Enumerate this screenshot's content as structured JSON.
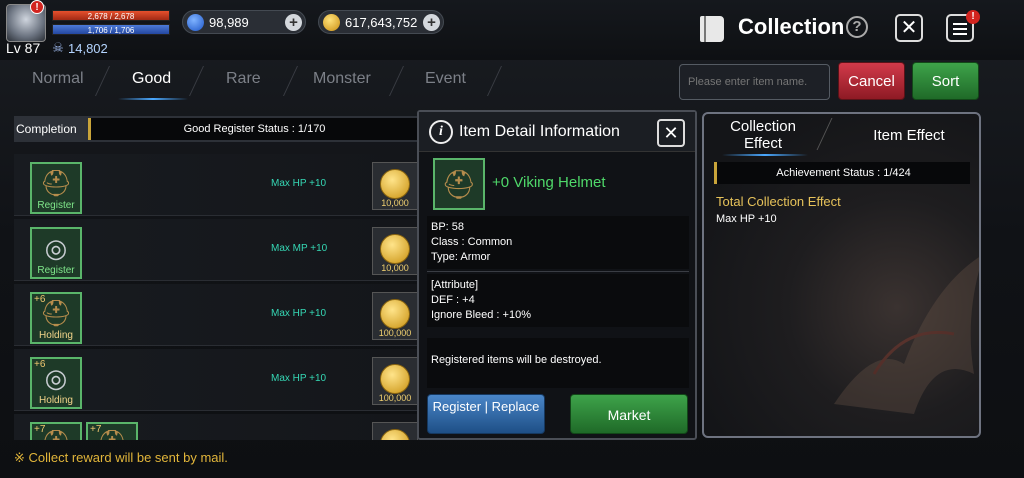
{
  "player": {
    "hp": "2,678 / 2,678",
    "hp_ratio": 1.0,
    "mp": "1,706 / 1,706",
    "mp_ratio": 1.0,
    "level": "Lv 87",
    "battle_power": "14,802",
    "avatar_badge": "!"
  },
  "currencies": [
    {
      "value": "98,989",
      "icon": "blue-gem-icon"
    },
    {
      "value": "617,643,752",
      "icon": "gold-coin-icon"
    }
  ],
  "header": {
    "title": "Collection",
    "menu_badge": "!"
  },
  "tabs": [
    "Normal",
    "Good",
    "Rare",
    "Monster",
    "Event"
  ],
  "active_tab": "Good",
  "search": {
    "placeholder": "Please enter item name."
  },
  "buttons": {
    "cancel": "Cancel",
    "sort": "Sort"
  },
  "completion": {
    "label": "Completion",
    "status": "Good Register Status : 1/170"
  },
  "rows": [
    {
      "state": "Register",
      "plus": "",
      "effect": "Max HP +10",
      "reward": "10,000",
      "icon": "helmet-icon"
    },
    {
      "state": "Register",
      "plus": "",
      "effect": "Max MP +10",
      "reward": "10,000",
      "icon": "ring-icon"
    },
    {
      "state": "Holding",
      "plus": "+6",
      "effect": "Max HP +10",
      "reward": "100,000",
      "icon": "helmet-icon"
    },
    {
      "state": "Holding",
      "plus": "+6",
      "effect": "Max HP +10",
      "reward": "100,000",
      "icon": "ring-icon"
    },
    {
      "state": "",
      "plus": "+7",
      "effect": "",
      "reward": "",
      "icon": "helmet-icon"
    }
  ],
  "footnote": "※ Collect reward will be sent by mail.",
  "detail": {
    "title": "Item Detail Information",
    "item_name": "+0 Viking Helmet",
    "bp": "BP: 58",
    "class": "Class : Common",
    "type": "Type: Armor",
    "attribute_header": "[Attribute]",
    "def": "DEF : +4",
    "ignore_bleed": "Ignore Bleed : +10%",
    "warning": "Registered items will be destroyed.",
    "register_label": "Register | Replace",
    "market_label": "Market"
  },
  "right_panel": {
    "tab1": "Collection Effect",
    "tab2": "Item Effect",
    "achievement": "Achievement Status : 1/424",
    "total_title": "Total Collection Effect",
    "total_value": "Max HP +10"
  }
}
